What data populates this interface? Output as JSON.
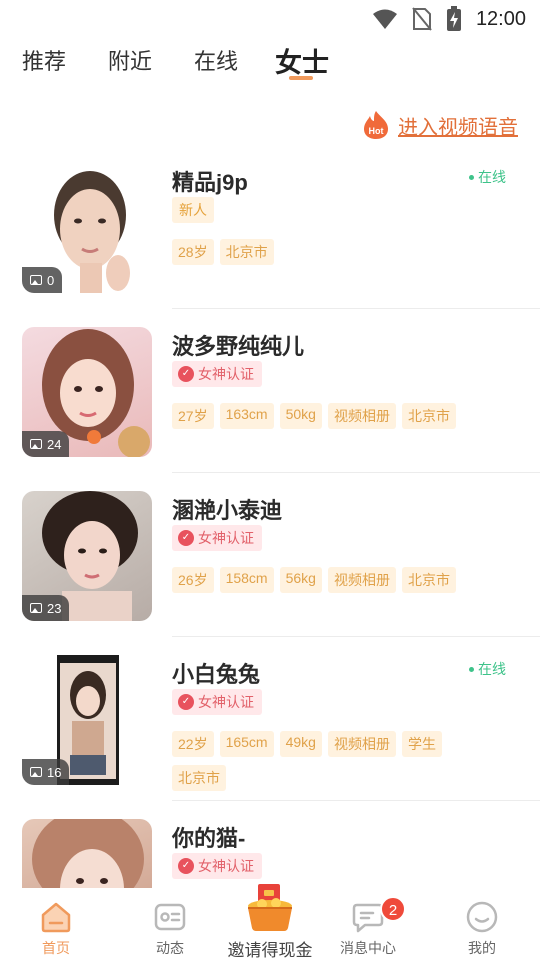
{
  "status_bar": {
    "time": "12:00"
  },
  "tabs": [
    {
      "label": "推荐"
    },
    {
      "label": "附近"
    },
    {
      "label": "在线"
    },
    {
      "label": "女士"
    }
  ],
  "promo": {
    "icon_text": "Hot",
    "label": "进入视频语音"
  },
  "profiles": [
    {
      "name": "精品j9p",
      "online": "在线",
      "badge": "新人",
      "photo_count": "0",
      "tags": [
        "28岁",
        "北京市"
      ]
    },
    {
      "name": "波多野纯纯儿",
      "online": "",
      "badge": "女神认证",
      "photo_count": "24",
      "tags": [
        "27岁",
        "163cm",
        "50kg",
        "视频相册",
        "北京市"
      ]
    },
    {
      "name": "溷滟小泰迪",
      "online": "",
      "badge": "女神认证",
      "photo_count": "23",
      "tags": [
        "26岁",
        "158cm",
        "56kg",
        "视频相册",
        "北京市"
      ]
    },
    {
      "name": "小白兔兔",
      "online": "在线",
      "badge": "女神认证",
      "photo_count": "16",
      "tags": [
        "22岁",
        "165cm",
        "49kg",
        "视频相册",
        "学生",
        "北京市"
      ]
    },
    {
      "name": "你的猫-",
      "online": "",
      "badge": "女神认证",
      "photo_count": "",
      "tags": []
    }
  ],
  "bottom_nav": {
    "home": "首页",
    "feed": "动态",
    "invite": "邀请得现金",
    "messages": "消息中心",
    "messages_badge": "2",
    "me": "我的"
  },
  "colors": {
    "accent": "#f09a5c",
    "online": "#3ec38a",
    "tag_text": "#e0a24a",
    "badge_red": "#e8525d"
  }
}
